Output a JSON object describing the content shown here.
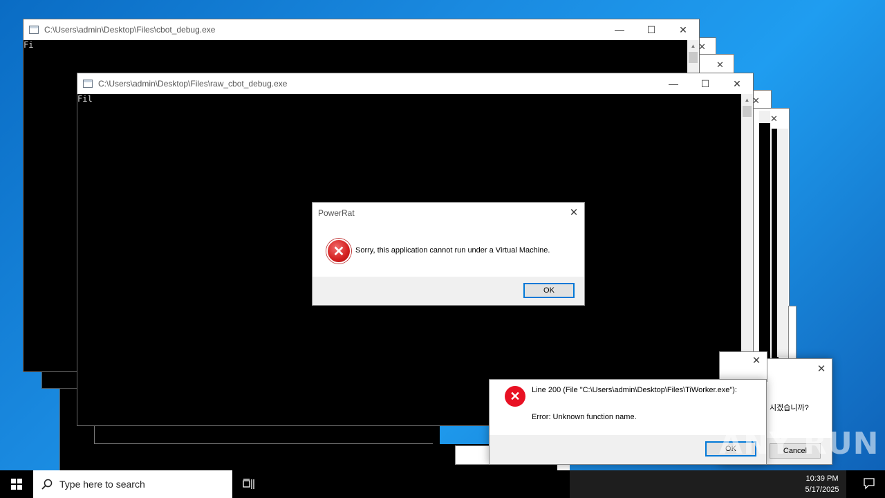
{
  "windows": {
    "back_console": {
      "title": "C:\\Users\\admin\\Desktop\\Files\\cbot_debug.exe",
      "output": "Fi"
    },
    "front_console": {
      "title": "C:\\Users\\admin\\Desktop\\Files\\raw_cbot_debug.exe",
      "output": "Fil"
    },
    "controls": {
      "minimize": "—",
      "maximize": "☐",
      "close": "✕"
    }
  },
  "dialog_powerrat": {
    "title": "PowerRat",
    "message": "Sorry, this application cannot run under a Virtual Machine.",
    "ok_label": "OK"
  },
  "dialog_autoit": {
    "line1": "Line 200  (File \"C:\\Users\\admin\\Desktop\\Files\\TiWorker.exe\"):",
    "line2": "Error: Unknown function name.",
    "ok_label": "OK"
  },
  "dialog_korean": {
    "message_fragment": "시겠습니까?",
    "cancel_label": "Cancel"
  },
  "taskbar": {
    "search_placeholder": "Type here to search",
    "time": "10:39 PM",
    "date": "5/17/2025"
  },
  "watermark": "ANY RUN",
  "icons": {
    "start": "windows-logo-icon",
    "search": "search-icon",
    "task_view": "task-view-icon",
    "notifications": "notification-icon",
    "error": "error-icon"
  },
  "colors": {
    "accent": "#0078d7",
    "error_red": "#e81123"
  }
}
